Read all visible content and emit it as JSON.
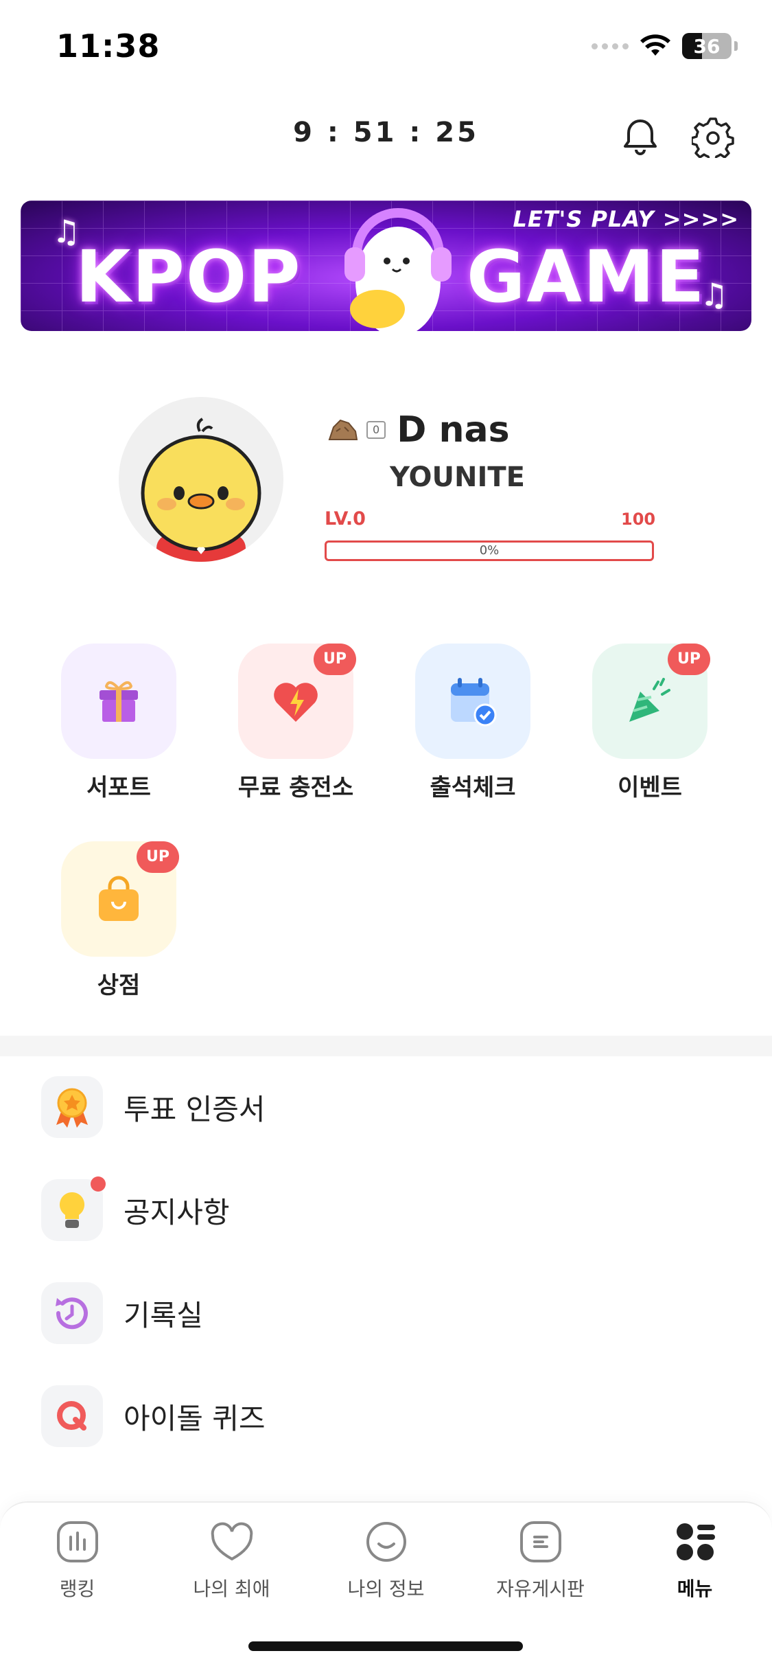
{
  "status_bar": {
    "time": "11:38",
    "battery": "36"
  },
  "header": {
    "timer": "9 : 51 : 25"
  },
  "banner": {
    "left_text": "KPOP",
    "right_text": "GAME",
    "tag": "LET'S PLAY >>>>"
  },
  "profile": {
    "rock_count": "0",
    "name": "D nas",
    "group": "YOUNITE",
    "level": "LV.0",
    "level_max": "100",
    "progress_text": "0%",
    "progress_fraction": 0
  },
  "quick_menu": [
    {
      "label": "서포트",
      "badge": ""
    },
    {
      "label": "무료 충전소",
      "badge": "UP"
    },
    {
      "label": "출석체크",
      "badge": ""
    },
    {
      "label": "이벤트",
      "badge": "UP"
    },
    {
      "label": "상점",
      "badge": "UP"
    }
  ],
  "menu_list": [
    {
      "label": "투표 인증서"
    },
    {
      "label": "공지사항"
    },
    {
      "label": "기록실"
    },
    {
      "label": "아이돌 퀴즈"
    }
  ],
  "tabs": [
    {
      "label": "랭킹"
    },
    {
      "label": "나의 최애"
    },
    {
      "label": "나의 정보"
    },
    {
      "label": "자유게시판"
    },
    {
      "label": "메뉴"
    }
  ],
  "colors": {
    "accent_red": "#e24a4a",
    "badge_red": "#f05a5a"
  }
}
